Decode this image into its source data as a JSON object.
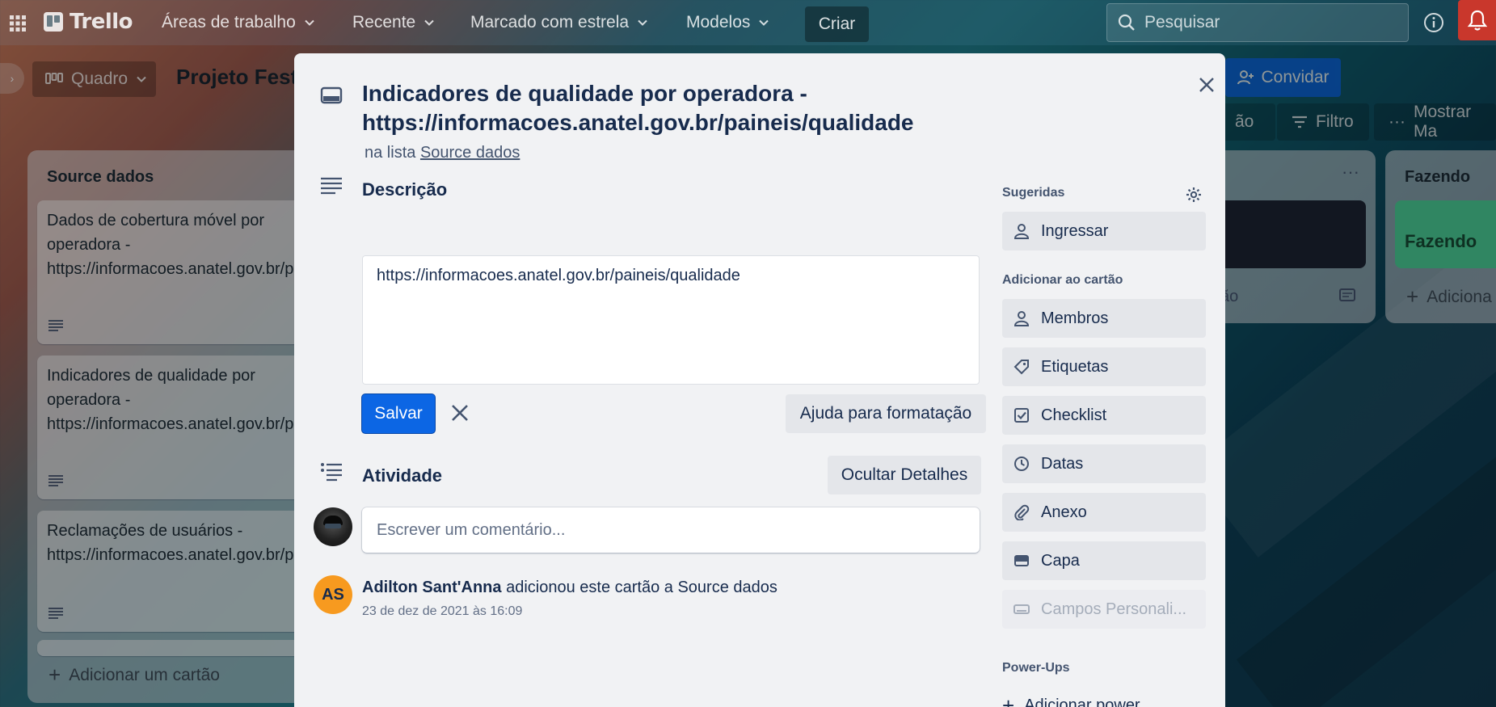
{
  "topbar": {
    "logo": "Trello",
    "nav": [
      "Áreas de trabalho",
      "Recente",
      "Marcado com estrela",
      "Modelos"
    ],
    "create": "Criar",
    "search_placeholder": "Pesquisar"
  },
  "board": {
    "view": "Quadro",
    "title": "Projeto Fest",
    "invite": "Convidar",
    "filter": "Filtro",
    "show_menu": "Mostrar Ma",
    "automation_partial": "ão"
  },
  "lists": [
    {
      "title": "Source dados",
      "cards": [
        "Dados de cobertura móvel por operadora - https://informacoes.anatel.gov.br/paineis/infraestrutura",
        "Indicadores de qualidade por operadora - https://informacoes.anatel.gov.br/paineis/qualidade",
        "Reclamações de usuários - https://informacoes.anatel.gov.br/paineis/consumidor"
      ],
      "add_card": "Adicionar um cartão"
    },
    {
      "title": "",
      "partial_text": "ão",
      "menu": "···"
    },
    {
      "title": "Fazendo",
      "card_label": "Fazendo",
      "add_partial": "Adiciona"
    }
  ],
  "modal": {
    "title": "Indicadores de qualidade por operadora - https://informacoes.anatel.gov.br/paineis/qualidade",
    "in_list_prefix": "na lista",
    "in_list_name": "Source dados",
    "description": {
      "heading": "Descrição",
      "value": "https://informacoes.anatel.gov.br/paineis/qualidade",
      "save": "Salvar",
      "format_help": "Ajuda para formatação"
    },
    "activity": {
      "heading": "Atividade",
      "toggle": "Ocultar Detalhes",
      "comment_placeholder": "Escrever um comentário...",
      "entries": [
        {
          "initials": "AS",
          "user": "Adilton Sant'Anna",
          "action": " adicionou este cartão a Source dados",
          "time": "23 de dez de 2021 às 16:09"
        }
      ]
    },
    "sidebar": {
      "suggested_label": "Sugeridas",
      "join": "Ingressar",
      "add_to_card_label": "Adicionar ao cartão",
      "buttons": [
        "Membros",
        "Etiquetas",
        "Checklist",
        "Datas",
        "Anexo",
        "Capa",
        "Campos Personali..."
      ],
      "powerups_label": "Power-Ups",
      "add_powerup": "Adicionar power"
    }
  },
  "colors": {
    "primary": "#0c66e4",
    "green_label": "#4bce97",
    "notification": "#c9372c",
    "avatar_as": "#f79a1f"
  }
}
